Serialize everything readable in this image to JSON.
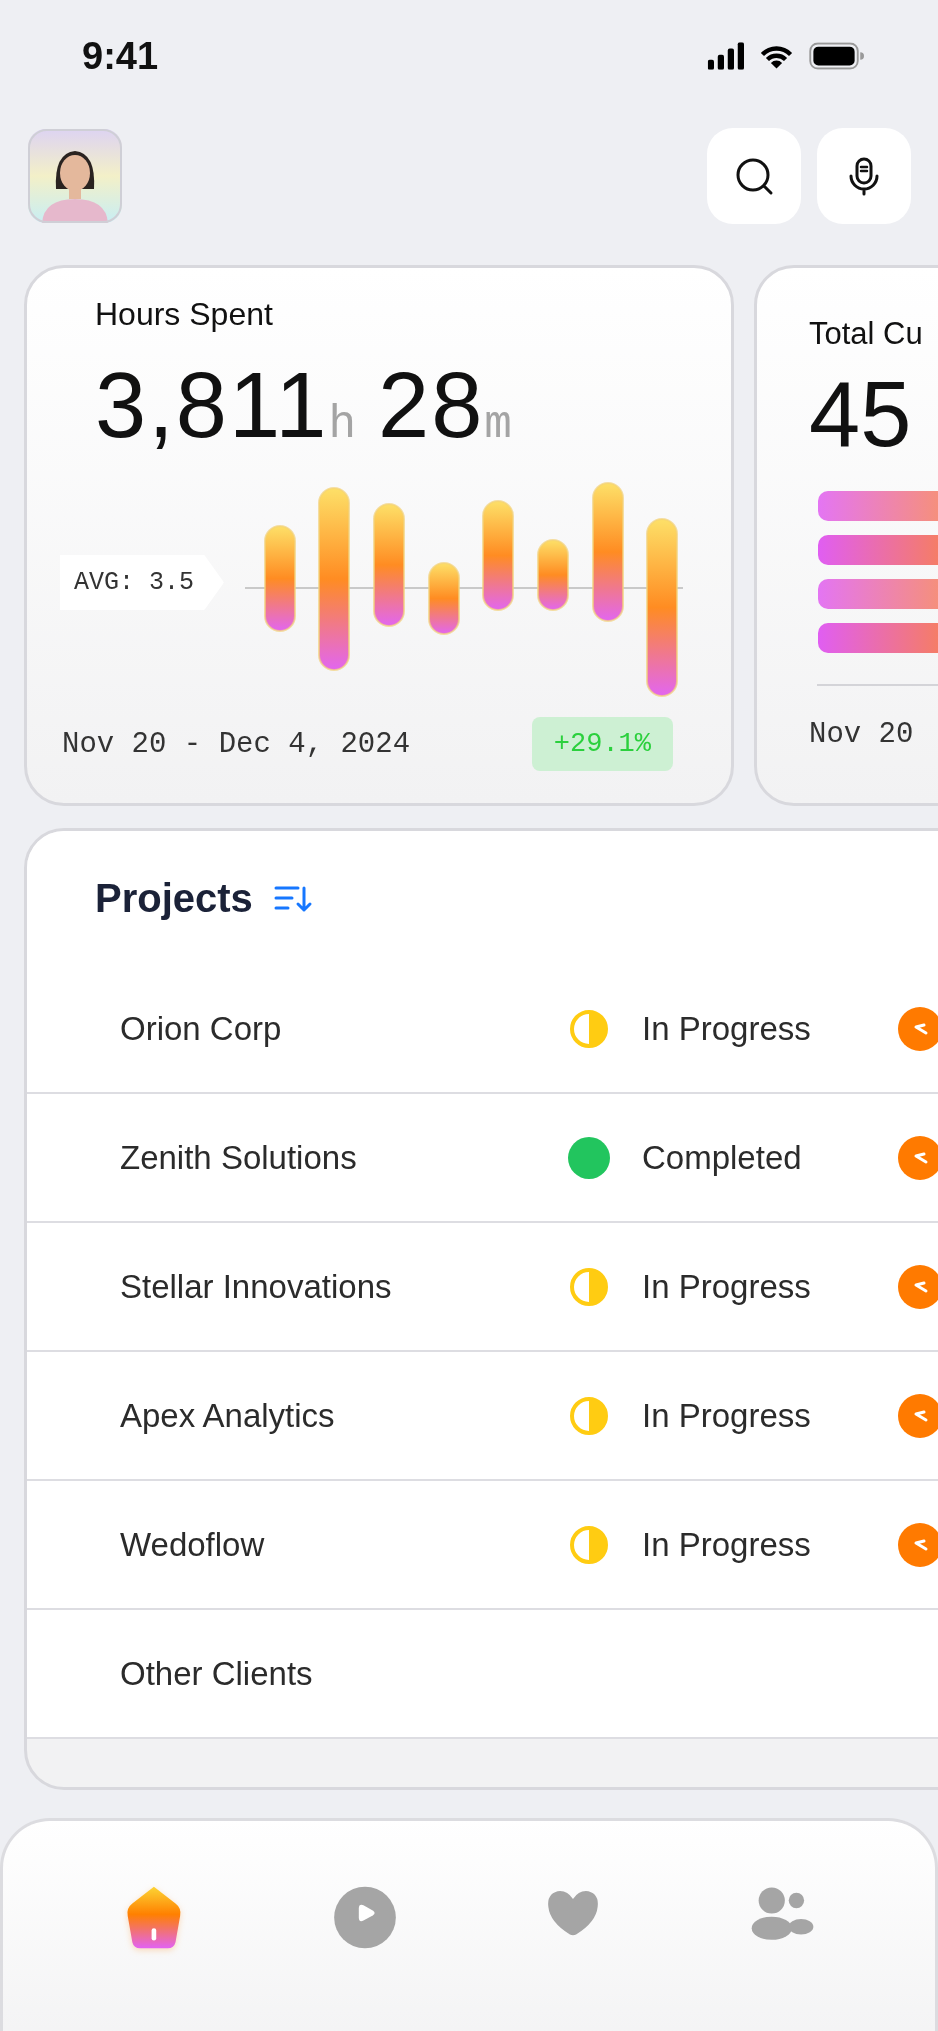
{
  "status_bar": {
    "time": "9:41"
  },
  "hours_card": {
    "title": "Hours Spent",
    "value": [
      {
        "text": "3,811",
        "kind": "number"
      },
      {
        "text": "h",
        "kind": "unit"
      },
      {
        "text": "28",
        "kind": "number"
      },
      {
        "text": "m",
        "kind": "unit"
      }
    ],
    "average_label": "AVG: 3.5",
    "date_range": "Nov 20 - Dec 4, 2024",
    "change": "+29.1%"
  },
  "customers_card": {
    "title": "Total Cu",
    "value": "45",
    "date_range": "Nov 20"
  },
  "projects": {
    "title": "Projects",
    "rows": [
      {
        "name": "Orion Corp",
        "kind": "in_progress",
        "status": "In Progress",
        "marker": true
      },
      {
        "name": "Zenith Solutions",
        "kind": "completed",
        "status": "Completed",
        "marker": true
      },
      {
        "name": "Stellar Innovations",
        "kind": "in_progress",
        "status": "In Progress",
        "marker": true
      },
      {
        "name": "Apex Analytics",
        "kind": "in_progress",
        "status": "In Progress",
        "marker": true
      },
      {
        "name": "Wedoflow",
        "kind": "in_progress",
        "status": "In Progress",
        "marker": true
      },
      {
        "name": "Other Clients",
        "marker": false
      }
    ]
  },
  "nav": {
    "items": [
      {
        "kind": "home",
        "selected": true
      },
      {
        "kind": "play",
        "selected": false
      },
      {
        "kind": "heart",
        "selected": false
      },
      {
        "kind": "people",
        "selected": false
      }
    ]
  }
}
